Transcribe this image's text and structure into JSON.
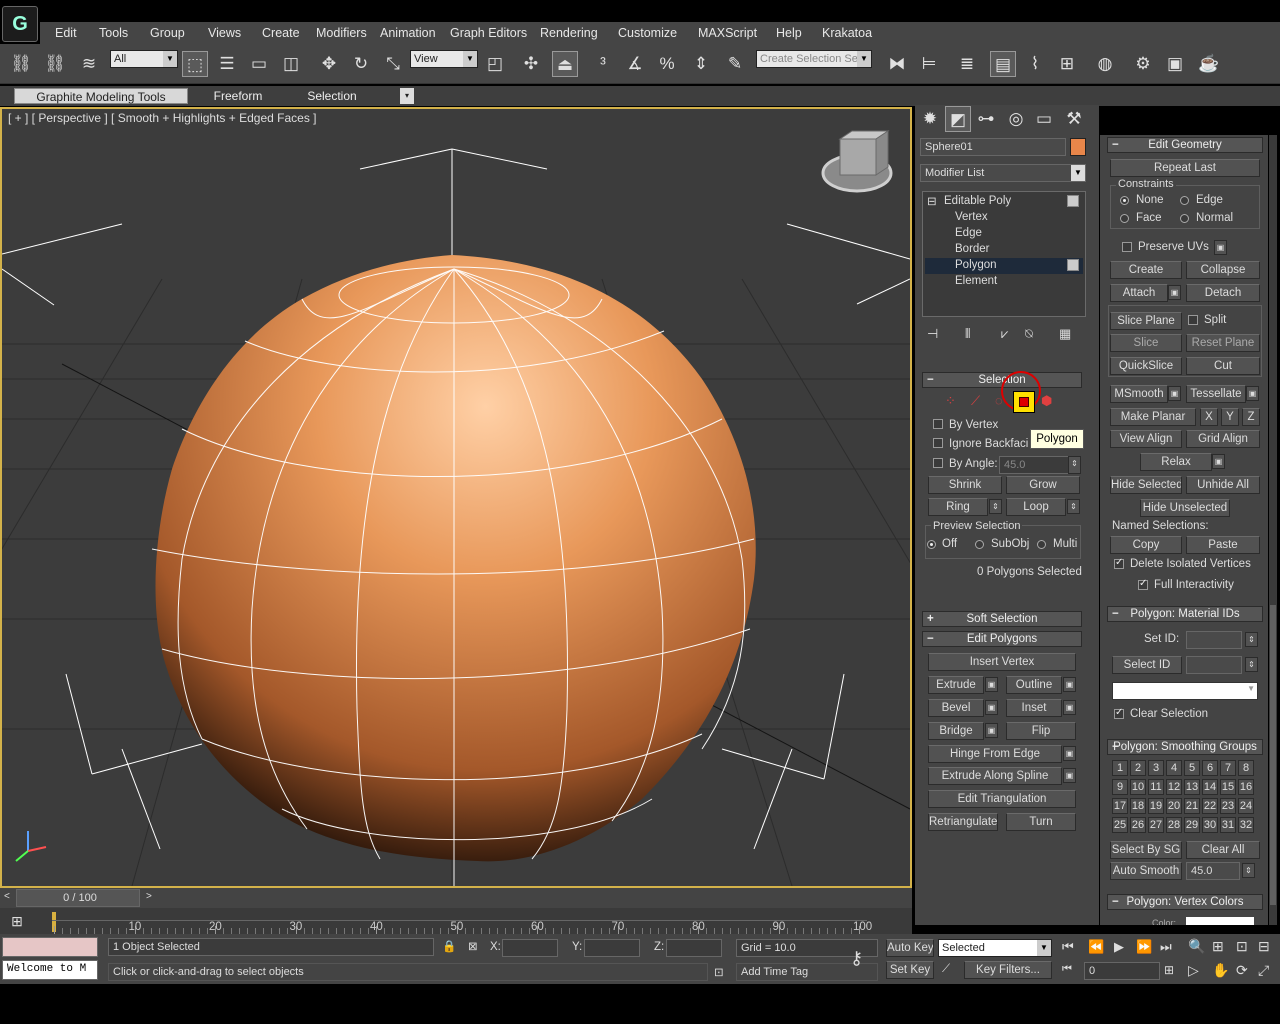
{
  "menu": {
    "items": [
      "Edit",
      "Tools",
      "Group",
      "Views",
      "Create",
      "Modifiers",
      "Animation",
      "Graph Editors",
      "Rendering",
      "Customize",
      "MAXScript",
      "Help",
      "Krakatoa"
    ]
  },
  "toolbar": {
    "selection_filter": "All",
    "ref_coord": "View",
    "named_selection_placeholder": "Create Selection Se"
  },
  "ribbon": {
    "tabs": [
      "Graphite Modeling Tools",
      "Freeform",
      "Selection"
    ]
  },
  "viewport": {
    "label": "[ + ] [ Perspective ] [ Smooth + Highlights + Edged Faces ]",
    "object_color": "#e8985a",
    "border_color": "#d3b24a"
  },
  "command_panel": {
    "object_name": "Sphere01",
    "object_color": "#e8864a",
    "modifier_list_label": "Modifier List",
    "stack": [
      "Editable Poly",
      "Vertex",
      "Edge",
      "Border",
      "Polygon",
      "Element"
    ],
    "selected_stack_item": "Polygon"
  },
  "selection_rollout": {
    "title": "Selection",
    "tooltip": "Polygon",
    "by_vertex": "By Vertex",
    "ignore_backfacing": "Ignore Backfacing",
    "by_angle": "By Angle:",
    "angle_value": "45.0",
    "shrink": "Shrink",
    "grow": "Grow",
    "ring": "Ring",
    "loop": "Loop",
    "preview_selection": "Preview Selection",
    "preview_options": [
      "Off",
      "SubObj",
      "Multi"
    ],
    "status": "0 Polygons Selected"
  },
  "soft_selection": {
    "title": "Soft Selection"
  },
  "edit_polygons": {
    "title": "Edit Polygons",
    "insert_vertex": "Insert Vertex",
    "extrude": "Extrude",
    "outline": "Outline",
    "bevel": "Bevel",
    "inset": "Inset",
    "bridge": "Bridge",
    "flip": "Flip",
    "hinge_from_edge": "Hinge From Edge",
    "extrude_along_spline": "Extrude Along Spline",
    "edit_triangulation": "Edit Triangulation",
    "retriangulate": "Retriangulate",
    "turn": "Turn"
  },
  "edit_geometry": {
    "title": "Edit Geometry",
    "repeat_last": "Repeat Last",
    "constraints": "Constraints",
    "constraint_options": [
      "None",
      "Edge",
      "Face",
      "Normal"
    ],
    "preserve_uvs": "Preserve UVs",
    "create": "Create",
    "collapse": "Collapse",
    "attach": "Attach",
    "detach": "Detach",
    "slice_plane": "Slice Plane",
    "split": "Split",
    "slice": "Slice",
    "reset_plane": "Reset Plane",
    "quickslice": "QuickSlice",
    "cut": "Cut",
    "msmooth": "MSmooth",
    "tessellate": "Tessellate",
    "make_planar": "Make Planar",
    "x": "X",
    "y": "Y",
    "z": "Z",
    "view_align": "View Align",
    "grid_align": "Grid Align",
    "relax": "Relax",
    "hide_selected": "Hide Selected",
    "unhide_all": "Unhide All",
    "hide_unselected": "Hide Unselected",
    "named_selections": "Named Selections:",
    "copy": "Copy",
    "paste": "Paste",
    "delete_isolated": "Delete Isolated Vertices",
    "full_interactivity": "Full Interactivity"
  },
  "material_ids": {
    "title": "Polygon: Material IDs",
    "set_id": "Set ID:",
    "select_id": "Select ID",
    "clear_selection": "Clear Selection"
  },
  "smoothing_groups": {
    "title": "Polygon: Smoothing Groups",
    "numbers": [
      "1",
      "2",
      "3",
      "4",
      "5",
      "6",
      "7",
      "8",
      "9",
      "10",
      "11",
      "12",
      "13",
      "14",
      "15",
      "16",
      "17",
      "18",
      "19",
      "20",
      "21",
      "22",
      "23",
      "24",
      "25",
      "26",
      "27",
      "28",
      "29",
      "30",
      "31",
      "32"
    ],
    "select_by_sg": "Select By SG",
    "clear_all": "Clear All",
    "auto_smooth": "Auto Smooth",
    "auto_smooth_value": "45.0"
  },
  "vertex_colors": {
    "title": "Polygon: Vertex Colors",
    "color": "Color:"
  },
  "timeline": {
    "frame_label": "0 / 100",
    "ticks": [
      "0",
      "10",
      "20",
      "30",
      "40",
      "50",
      "60",
      "70",
      "80",
      "90",
      "100"
    ]
  },
  "status": {
    "objects_selected": "1 Object Selected",
    "prompt": "Click or click-and-drag to select objects",
    "maxscript": "Welcome to M",
    "x_label": "X:",
    "y_label": "Y:",
    "z_label": "Z:",
    "grid": "Grid = 10.0",
    "add_time_tag": "Add Time Tag",
    "auto_key": "Auto Key",
    "set_key": "Set Key",
    "key_mode": "Selected",
    "key_filters": "Key Filters...",
    "frame": "0"
  }
}
